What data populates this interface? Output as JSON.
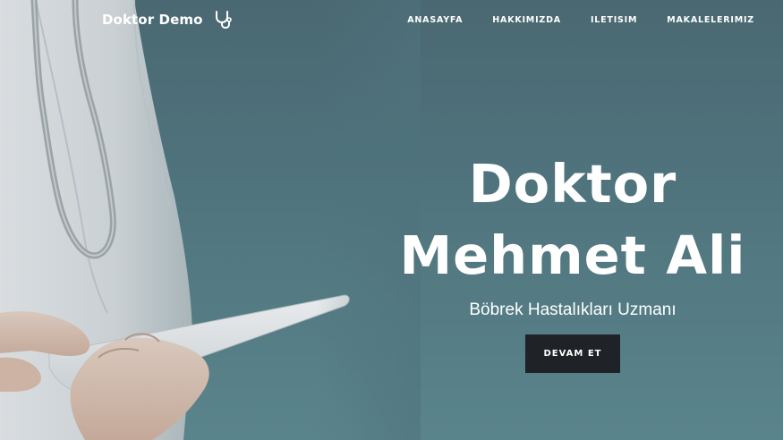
{
  "brand": {
    "name": "Doktor Demo",
    "icon": "stethoscope-icon"
  },
  "nav": {
    "items": [
      {
        "label": "ANASAYFA"
      },
      {
        "label": "HAKKIMIZDA"
      },
      {
        "label": "ILETISIM"
      },
      {
        "label": "MAKALELERIMIZ"
      }
    ]
  },
  "hero": {
    "title_line1": "Doktor",
    "title_line2": "Mehmet Ali",
    "subtitle": "Böbrek Hastalıkları Uzmanı",
    "cta_label": "DEVAM ET"
  },
  "colors": {
    "background": "#4f737c",
    "cta_background": "#1f2328",
    "text": "#ffffff"
  }
}
